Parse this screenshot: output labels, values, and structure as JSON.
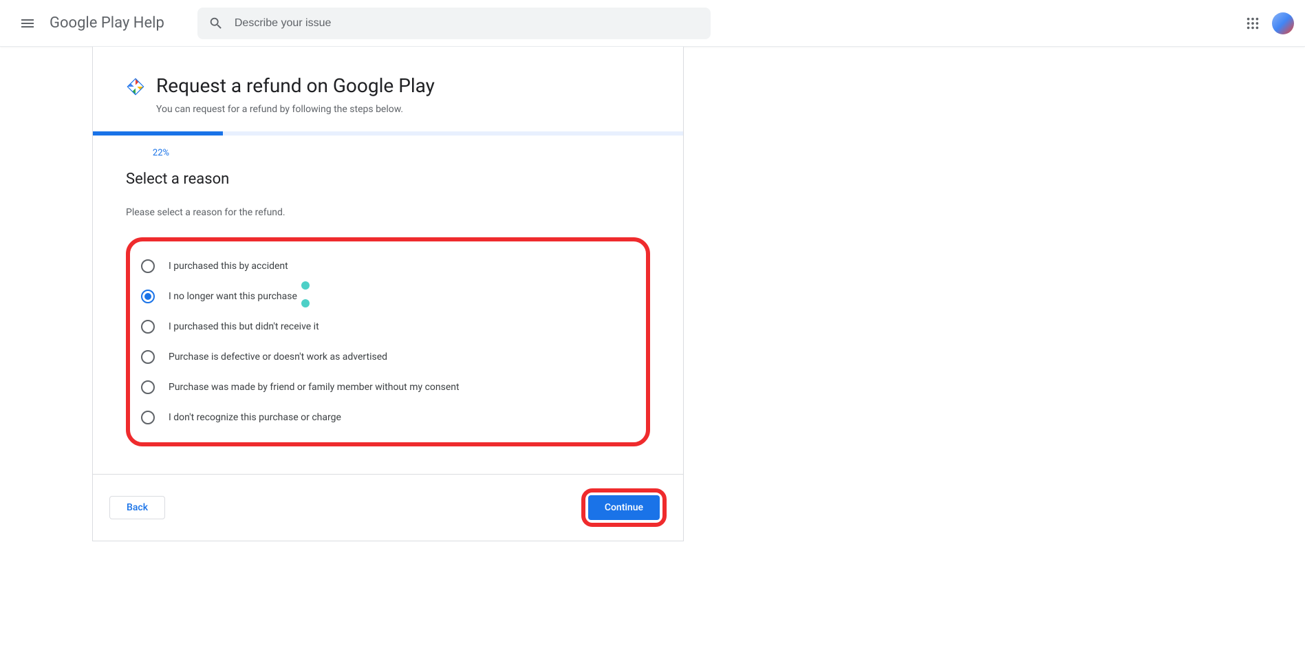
{
  "header": {
    "logo_text": "Google Play Help",
    "search_placeholder": "Describe your issue"
  },
  "card": {
    "title": "Request a refund on Google Play",
    "subtitle": "You can request for a refund by following the steps below.",
    "progress_text": "22%",
    "progress_percent": 22
  },
  "form": {
    "heading": "Select a reason",
    "sub": "Please select a reason for the refund.",
    "options": [
      {
        "label": "I purchased this by accident",
        "checked": false
      },
      {
        "label": "I no longer want this purchase",
        "checked": true
      },
      {
        "label": "I purchased this but didn't receive it",
        "checked": false
      },
      {
        "label": "Purchase is defective or doesn't work as advertised",
        "checked": false
      },
      {
        "label": "Purchase was made by friend or family member without my consent",
        "checked": false
      },
      {
        "label": "I don't recognize this purchase or charge",
        "checked": false
      }
    ]
  },
  "footer": {
    "back": "Back",
    "continue": "Continue"
  }
}
